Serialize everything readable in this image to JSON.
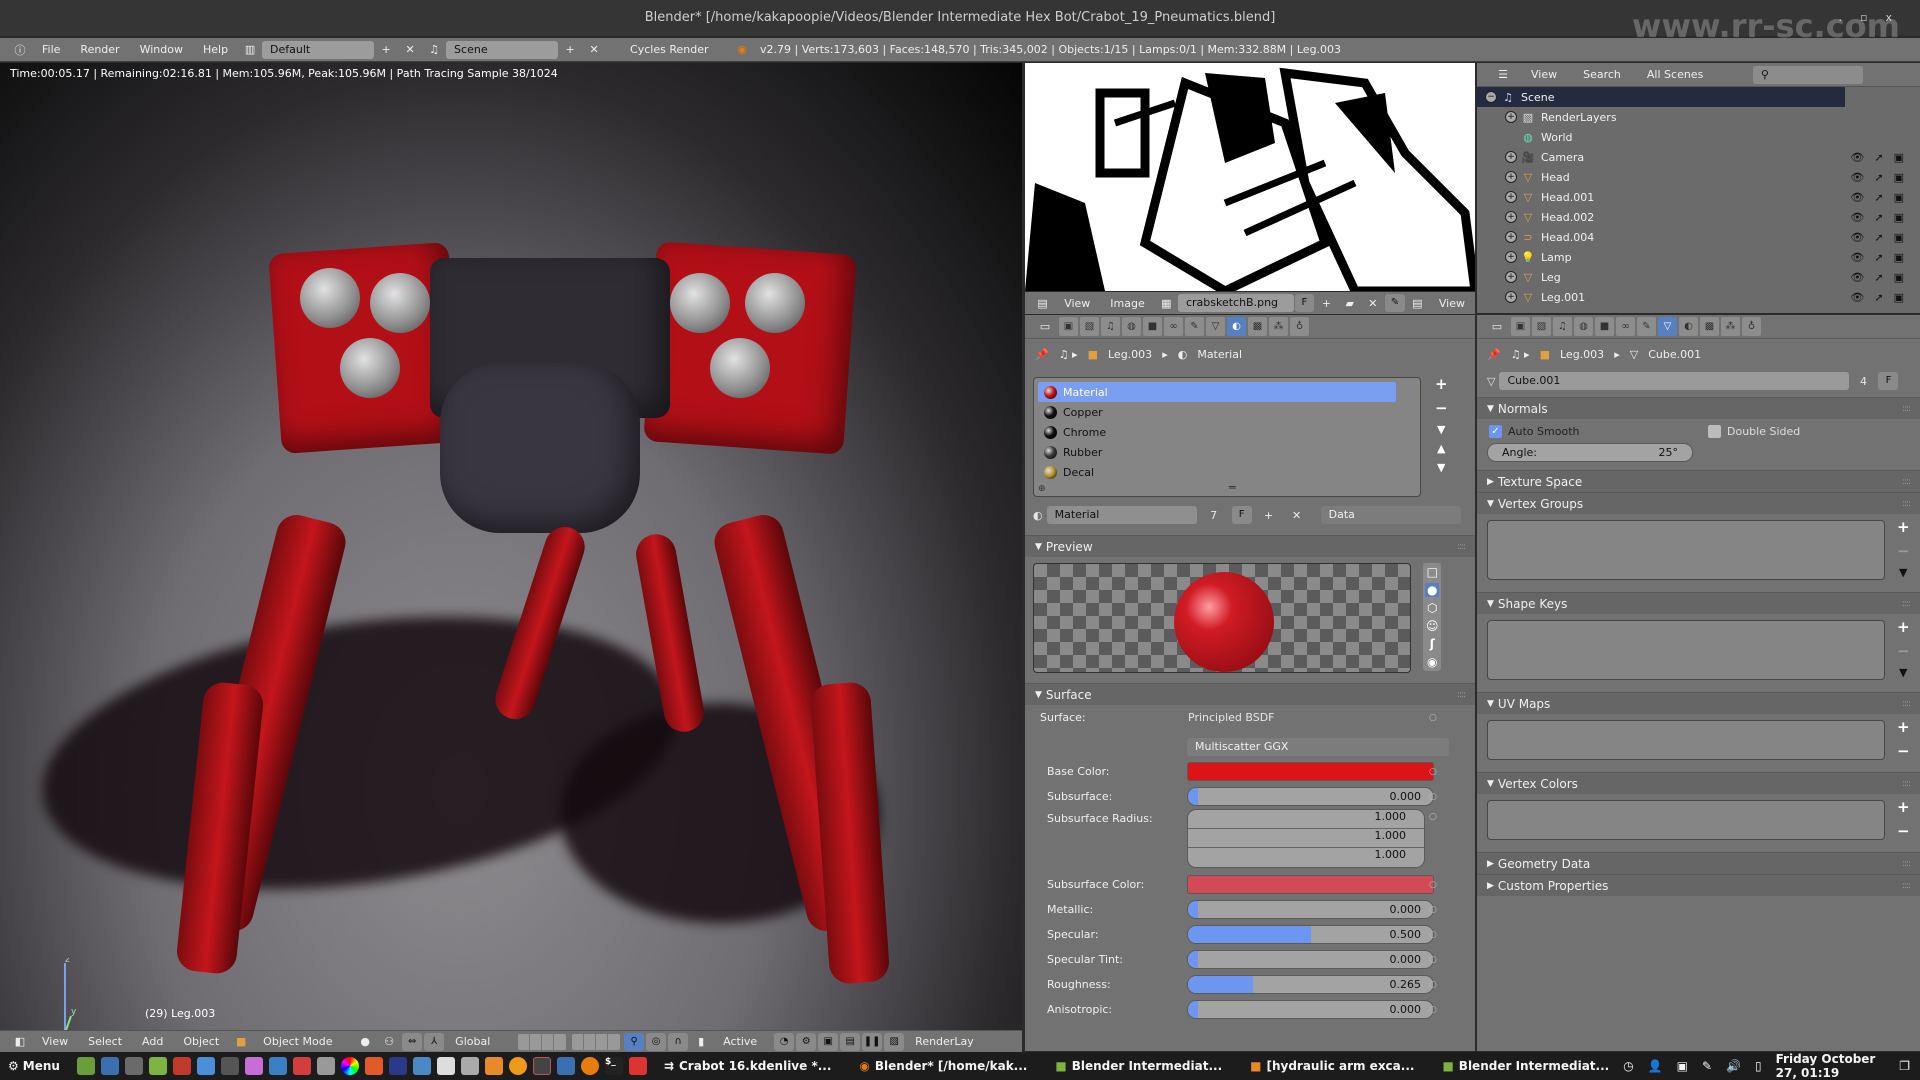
{
  "window": {
    "title": "Blender* [/home/kakapoopie/Videos/Blender Intermediate Hex Bot/Crabot_19_Pneumatics.blend]",
    "watermark": "www.rr-sc.com",
    "controls": [
      "minimize",
      "maximize",
      "close"
    ]
  },
  "top_header": {
    "menus": [
      "File",
      "Render",
      "Window",
      "Help"
    ],
    "screen_layout": "Default",
    "scene": "Scene",
    "render_engine": "Cycles Render",
    "stats": "v2.79 | Verts:173,603 | Faces:148,570 | Tris:345,002 | Objects:1/15 | Lamps:0/1 | Mem:332.88M | Leg.003"
  },
  "viewport": {
    "render_info": "Time:00:05.17 | Remaining:02:16.81 | Mem:105.96M, Peak:105.96M | Path Tracing Sample 38/1024",
    "object_label": "(29) Leg.003",
    "axis_labels": {
      "x": "",
      "y": "y",
      "z": "z"
    },
    "header": {
      "menus": [
        "View",
        "Select",
        "Add",
        "Object"
      ],
      "mode": "Object Mode",
      "orientation": "Global",
      "pivot": "Active",
      "render_layer": "RenderLay"
    }
  },
  "image_editor": {
    "menus": [
      "View",
      "Image"
    ],
    "image_name": "crabsketchB.png",
    "fake_user": "F",
    "view_label": "View"
  },
  "material_props": {
    "breadcrumb": [
      "Leg.003",
      "Material"
    ],
    "slots": [
      {
        "name": "Material",
        "color": "#c4121c",
        "selected": true
      },
      {
        "name": "Copper",
        "color": "#111111",
        "selected": false
      },
      {
        "name": "Chrome",
        "color": "#0d0d0d",
        "selected": false
      },
      {
        "name": "Rubber",
        "color": "#3a3a3a",
        "selected": false
      },
      {
        "name": "Decal",
        "color": "#b8962e",
        "selected": false
      }
    ],
    "datablock": {
      "name": "Material",
      "users": "7",
      "fake": "F",
      "link": "Data"
    },
    "preview_header": "Preview",
    "surface_header": "Surface",
    "surface_label": "Surface:",
    "surface_shader": "Principled BSDF",
    "distribution": "Multiscatter GGX",
    "base_color": {
      "label": "Base Color:",
      "hex": "#dc1418"
    },
    "subsurface": {
      "label": "Subsurface:",
      "value": "0.000",
      "fraction": 0.0
    },
    "subsurface_radius": {
      "label": "Subsurface Radius:",
      "values": [
        "1.000",
        "1.000",
        "1.000"
      ]
    },
    "subsurface_color": {
      "label": "Subsurface Color:",
      "hex": "#d24a55"
    },
    "metallic": {
      "label": "Metallic:",
      "value": "0.000",
      "fraction": 0.0
    },
    "specular": {
      "label": "Specular:",
      "value": "0.500",
      "fraction": 0.5
    },
    "specular_tint": {
      "label": "Specular Tint:",
      "value": "0.000",
      "fraction": 0.0
    },
    "roughness": {
      "label": "Roughness:",
      "value": "0.265",
      "fraction": 0.265
    },
    "anisotropic": {
      "label": "Anisotropic:",
      "value": "0.000",
      "fraction": 0.0
    }
  },
  "outliner": {
    "menus": [
      "View",
      "Search"
    ],
    "filter": "All Scenes",
    "search_placeholder": "",
    "items": [
      {
        "name": "Scene",
        "icon": "scene",
        "level": 0
      },
      {
        "name": "RenderLayers",
        "icon": "renderlayers",
        "level": 1
      },
      {
        "name": "World",
        "icon": "world",
        "level": 1
      },
      {
        "name": "Camera",
        "icon": "camera",
        "level": 1
      },
      {
        "name": "Head",
        "icon": "mesh",
        "level": 1
      },
      {
        "name": "Head.001",
        "icon": "mesh",
        "level": 1
      },
      {
        "name": "Head.002",
        "icon": "mesh",
        "level": 1
      },
      {
        "name": "Head.004",
        "icon": "curve",
        "level": 1
      },
      {
        "name": "Lamp",
        "icon": "lamp",
        "level": 1
      },
      {
        "name": "Leg",
        "icon": "mesh",
        "level": 1
      },
      {
        "name": "Leg.001",
        "icon": "mesh",
        "level": 1
      }
    ]
  },
  "mesh_props": {
    "breadcrumb": [
      "Leg.003",
      "Cube.001"
    ],
    "mesh_name": "Cube.001",
    "users": "4",
    "fake": "F",
    "panels": {
      "normals": "Normals",
      "auto_smooth": {
        "label": "Auto Smooth",
        "checked": true
      },
      "double_sided": {
        "label": "Double Sided",
        "checked": false
      },
      "angle": {
        "label": "Angle:",
        "value": "25°"
      },
      "texture_space": "Texture Space",
      "vertex_groups": "Vertex Groups",
      "shape_keys": "Shape Keys",
      "uv_maps": "UV Maps",
      "vertex_colors": "Vertex Colors",
      "geometry_data": "Geometry Data",
      "custom_properties": "Custom Properties"
    }
  },
  "taskbar": {
    "menu_label": "Menu",
    "tasks": [
      "Crabot 16.kdenlive *...",
      "Blender* [/home/kak...",
      "Blender Intermediat...",
      "[hydraulic arm exca...",
      "Blender Intermediat..."
    ],
    "clock": "Friday October 27, 01:19"
  }
}
